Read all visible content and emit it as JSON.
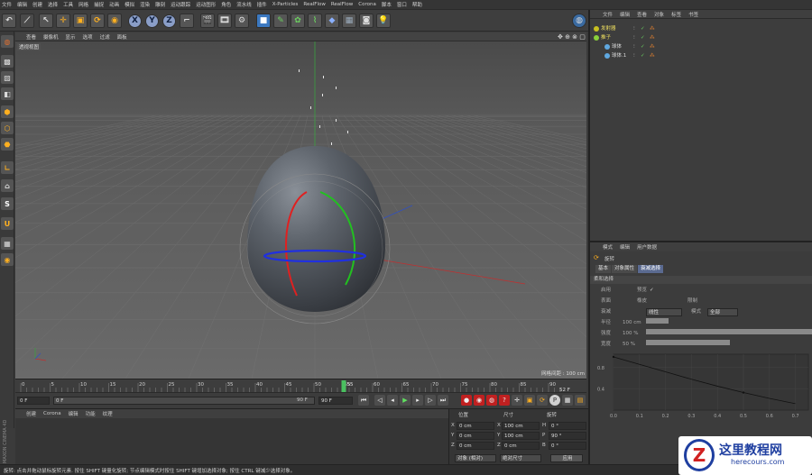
{
  "menu": [
    "文件",
    "编辑",
    "创建",
    "选择",
    "工具",
    "网格",
    "捕捉",
    "动画",
    "模拟",
    "渲染",
    "雕刻",
    "运动跟踪",
    "运动图形",
    "角色",
    "流水线",
    "插件",
    "X-Particles",
    "RealFlow",
    "RealFlow",
    "Corona",
    "脚本",
    "窗口",
    "帮助"
  ],
  "toolbar": {
    "axes": [
      "X",
      "Y",
      "Z"
    ]
  },
  "viewport": {
    "menu": [
      "查看",
      "摄像机",
      "显示",
      "选项",
      "过滤",
      "面板"
    ],
    "label": "透视视图",
    "grid_spacing": "网格间距 : 100 cm"
  },
  "timeline": {
    "ticks": [
      "0",
      "5",
      "10",
      "15",
      "20",
      "25",
      "30",
      "35",
      "40",
      "45",
      "50",
      "55",
      "60",
      "65",
      "70",
      "75",
      "80",
      "85",
      "90"
    ],
    "current": "55",
    "end_frame": "52 F"
  },
  "transport": {
    "start": "0 F",
    "range_start": "0 F",
    "range_end": "90 F",
    "end": "90 F"
  },
  "material": {
    "menu": [
      "创建",
      "Corona",
      "编辑",
      "功能",
      "纹理"
    ]
  },
  "coords": {
    "headers": [
      "位置",
      "尺寸",
      "旋转"
    ],
    "rows": [
      {
        "axis": "X",
        "pos": "0 cm",
        "sl": "X",
        "size": "100 cm",
        "rl": "H",
        "rot": "0 °"
      },
      {
        "axis": "Y",
        "pos": "0 cm",
        "sl": "Y",
        "size": "100 cm",
        "rl": "P",
        "rot": "90 °"
      },
      {
        "axis": "Z",
        "pos": "0 cm",
        "sl": "Z",
        "size": "0 cm",
        "rl": "B",
        "rot": "0 °"
      }
    ],
    "mode1": "对象 (相对)",
    "mode2": "绝对尺寸",
    "apply": "应用"
  },
  "objects": {
    "menu": [
      "文件",
      "编辑",
      "查看",
      "对象",
      "标签",
      "书签"
    ],
    "items": [
      {
        "name": "发射器",
        "color": "#c8c020",
        "indent": 0
      },
      {
        "name": "推子",
        "color": "#8ad03a",
        "indent": 0
      },
      {
        "name": "球体",
        "color": "#5fa8e0",
        "indent": 12
      },
      {
        "name": "球体.1",
        "color": "#5fa8e0",
        "indent": 12
      }
    ]
  },
  "attributes": {
    "menu": [
      "模式",
      "编辑",
      "用户数据"
    ],
    "object_name": "旋转",
    "tabs": [
      "基本",
      "对象属性",
      "衰减选择"
    ],
    "section": "柔和选择",
    "rows": [
      {
        "label": "启用",
        "extra": "预览"
      },
      {
        "label": "表面",
        "extra": "橡皮",
        "extra2": "限制"
      },
      {
        "label": "衰减",
        "value": "线性",
        "extra": "模式",
        "value2": "全部"
      },
      {
        "label": "半径",
        "value": "100 cm"
      },
      {
        "label": "强度",
        "value": "100 %"
      },
      {
        "label": "宽度",
        "value": "50 %"
      }
    ],
    "bars": {
      "radius": 0.2,
      "strength": 1.0,
      "width": 0.5
    },
    "curve": {
      "type": "line",
      "x": [
        0.0,
        0.1,
        0.2,
        0.3,
        0.4,
        0.5,
        0.6,
        0.7
      ],
      "y": [
        1.0,
        0.86,
        0.72,
        0.58,
        0.45,
        0.33,
        0.22,
        0.12
      ],
      "xticks": [
        "0.0",
        "0.1",
        "0.2",
        "0.3",
        "0.4",
        "0.5",
        "0.6",
        "0.7"
      ],
      "yticks": [
        "0.8",
        "0.4"
      ],
      "xlim": [
        0,
        0.75
      ],
      "ylim": [
        0,
        1.05
      ]
    }
  },
  "status": "旋转: 点击并拖动鼠标旋转元素. 按住 SHIFT 键量化旋转; 节点编辑模式时按住 SHIFT 键增加选择对象; 按住 CTRL 键减少选择对象。",
  "watermark": {
    "title": "这里教程网",
    "url": "herecours.com"
  }
}
